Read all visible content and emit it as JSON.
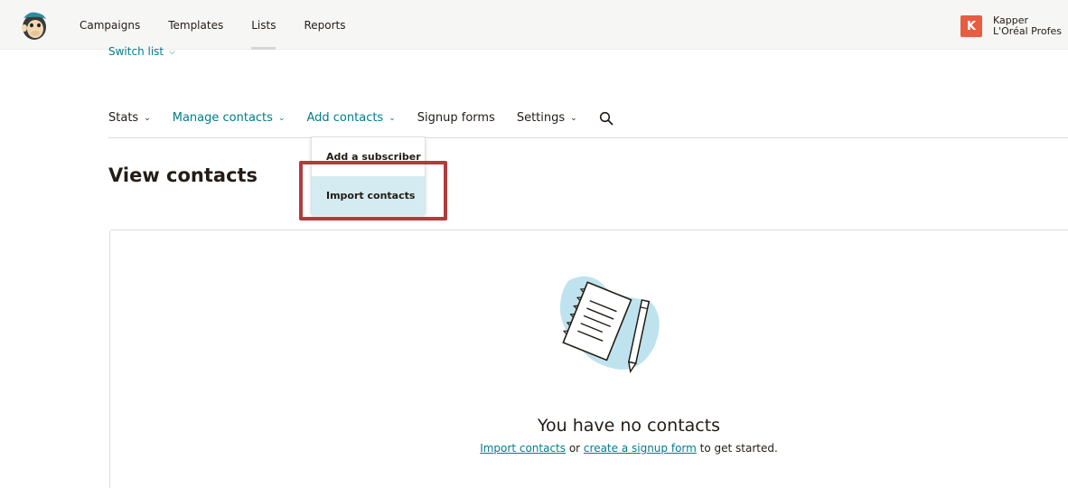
{
  "topnav": {
    "items": [
      {
        "label": "Campaigns"
      },
      {
        "label": "Templates"
      },
      {
        "label": "Lists"
      },
      {
        "label": "Reports"
      }
    ],
    "active_index": 2
  },
  "account": {
    "avatar_letter": "K",
    "name": "Kapper",
    "org": "L'Oréal Profes"
  },
  "switch_list": "Switch list",
  "subnav": {
    "stats": "Stats",
    "manage_contacts": "Manage contacts",
    "add_contacts": "Add contacts",
    "signup_forms": "Signup forms",
    "settings": "Settings",
    "search_icon": "search-icon"
  },
  "dropdown": {
    "items": [
      {
        "label": "Add a subscriber"
      },
      {
        "label": "Import contacts"
      }
    ]
  },
  "page_title": "View contacts",
  "empty_state": {
    "title": "You have no contacts",
    "link_import": "Import contacts",
    "or_text": " or ",
    "link_signup": "create a signup form",
    "suffix": " to get started."
  },
  "colors": {
    "teal": "#007c89",
    "highlight": "#b03c3c",
    "avatar": "#e85c41",
    "selected_bg": "#d4ecf1"
  }
}
